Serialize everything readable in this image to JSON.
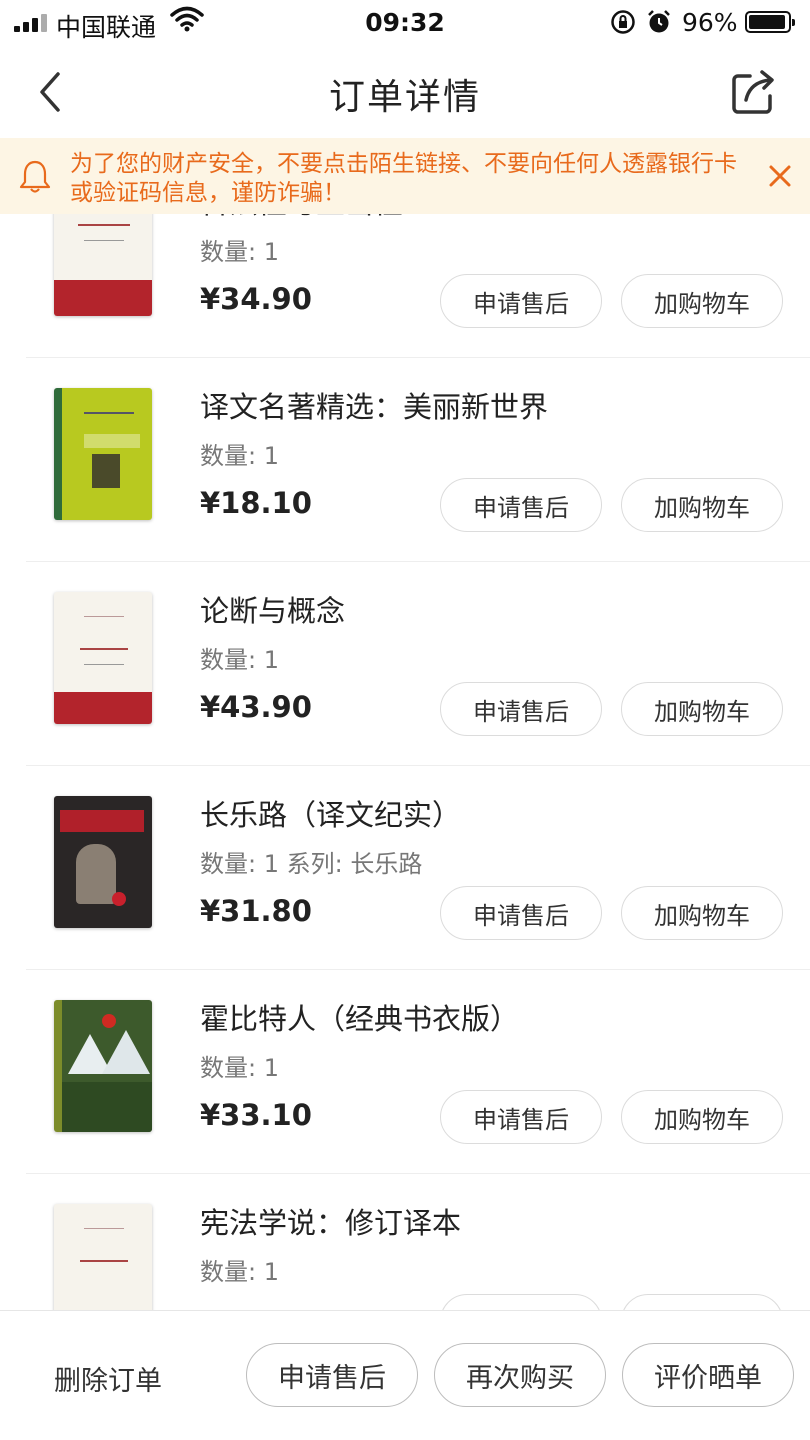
{
  "status_bar": {
    "carrier": "中国联通",
    "time": "09:32",
    "battery": "96%",
    "icons": [
      "signal-icon",
      "wifi-icon",
      "orientation-lock-icon",
      "alarm-icon",
      "battery-icon"
    ]
  },
  "nav": {
    "title": "订单详情",
    "back_icon": "chevron-left-icon",
    "share_icon": "share-icon"
  },
  "notice": {
    "text": "为了您的财产安全，不要点击陌生链接、不要向任何人透露银行卡或验证码信息，谨防诈骗！",
    "icon": "bell-icon",
    "close_icon": "close-icon",
    "color": "#e86a1c",
    "background": "#fdf5e4"
  },
  "items": [
    {
      "title": "合法性与正当性",
      "qty": "数量: 1",
      "price": "¥34.90",
      "after_label": "申请售后",
      "cart_label": "加购物车"
    },
    {
      "title": "译文名著精选：美丽新世界",
      "qty": "数量: 1",
      "price": "¥18.10",
      "after_label": "申请售后",
      "cart_label": "加购物车"
    },
    {
      "title": "论断与概念",
      "qty": "数量: 1",
      "price": "¥43.90",
      "after_label": "申请售后",
      "cart_label": "加购物车"
    },
    {
      "title": "长乐路（译文纪实）",
      "qty": "数量: 1 系列: 长乐路",
      "price": "¥31.80",
      "after_label": "申请售后",
      "cart_label": "加购物车"
    },
    {
      "title": "霍比特人（经典书衣版）",
      "qty": "数量: 1",
      "price": "¥33.10",
      "after_label": "申请售后",
      "cart_label": "加购物车"
    },
    {
      "title": "宪法学说：修订译本",
      "qty": "数量: 1",
      "price": "",
      "after_label": "",
      "cart_label": ""
    }
  ],
  "bottom": {
    "delete_label": "删除订单",
    "after_sales_label": "申请售后",
    "buy_again_label": "再次购买",
    "review_label": "评价晒单"
  }
}
